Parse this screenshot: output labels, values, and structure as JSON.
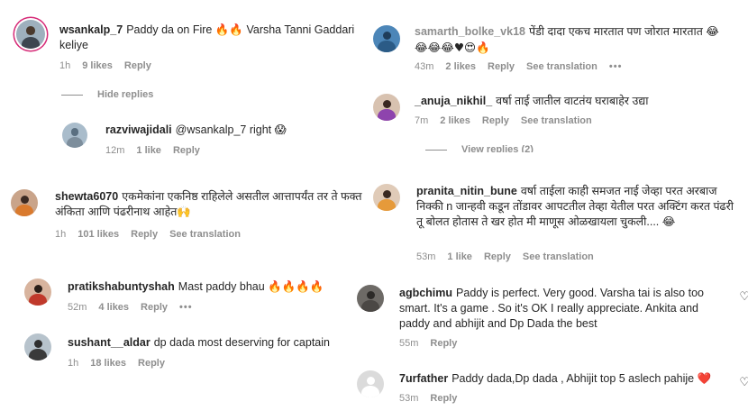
{
  "left": [
    {
      "user": "wsankalp_7",
      "text": "Paddy da on Fire 🔥🔥 Varsha Tanni Gaddari keliye",
      "time": "1h",
      "likes": "9 likes",
      "reply": "Reply",
      "replies_toggle": "Hide replies"
    },
    {
      "user": "razviwajidali",
      "text": "@wsankalp_7 right 😱",
      "time": "12m",
      "likes": "1 like",
      "reply": "Reply"
    },
    {
      "user": "shewta6070",
      "text": "एकमेकांना एकनिष्ठ राहिलेले असतील आत्तापर्यंत तर ते फक्त अंकिता आणि पंढरीनाथ आहेत🙌",
      "time": "1h",
      "likes": "101 likes",
      "reply": "Reply",
      "see_translation": "See translation"
    },
    {
      "user": "pratikshabuntyshah",
      "text": "Mast paddy bhau 🔥🔥🔥🔥",
      "time": "52m",
      "likes": "4 likes",
      "reply": "Reply",
      "more": "•••"
    },
    {
      "user": "sushant__aldar",
      "text": "dp dada most deserving for captain",
      "time": "1h",
      "likes": "18 likes",
      "reply": "Reply"
    }
  ],
  "right": [
    {
      "user": "samarth_bolke_vk18",
      "text": "पेंडी दादा एकच मारतात पण जोरात मारतात 😂",
      "text2": "😂😂😂♥😍🔥",
      "time": "43m",
      "likes": "2 likes",
      "reply": "Reply",
      "see_translation": "See translation",
      "more": "•••"
    },
    {
      "user": "_anuja_nikhil_",
      "text": "वर्षा ताई जातील वाटतंय घराबाहेर उद्या",
      "time": "7m",
      "likes": "2 likes",
      "reply": "Reply",
      "see_translation": "See translation",
      "replies_toggle": "View replies (2)"
    },
    {
      "user": "pranita_nitin_bune",
      "text": "वर्षा ताईला काही समजत नाई जेव्हा परत अरबाज निक्की n जान्हवी कडून तोंडावर आपटतील तेव्हा येतील परत अक्टिंग करत पंढरी तू बोलत होतास ते खर होत मी माणूस ओळखायला चुकली.... 😂",
      "time": "53m",
      "likes": "1 like",
      "reply": "Reply",
      "see_translation": "See translation"
    },
    {
      "user": "agbchimu",
      "text": "Paddy is perfect. Very good. Varsha tai is also too smart. It's a game . So it's OK I really appreciate. Ankita and paddy and abhijit and Dp Dada the best",
      "time": "55m",
      "reply": "Reply"
    },
    {
      "user": "7urfather",
      "text": "Paddy dada,Dp dada , Abhijit top 5 aslech pahije ❤️",
      "time": "53m",
      "reply": "Reply"
    }
  ],
  "icons": {
    "like": "heart-outline-icon"
  }
}
